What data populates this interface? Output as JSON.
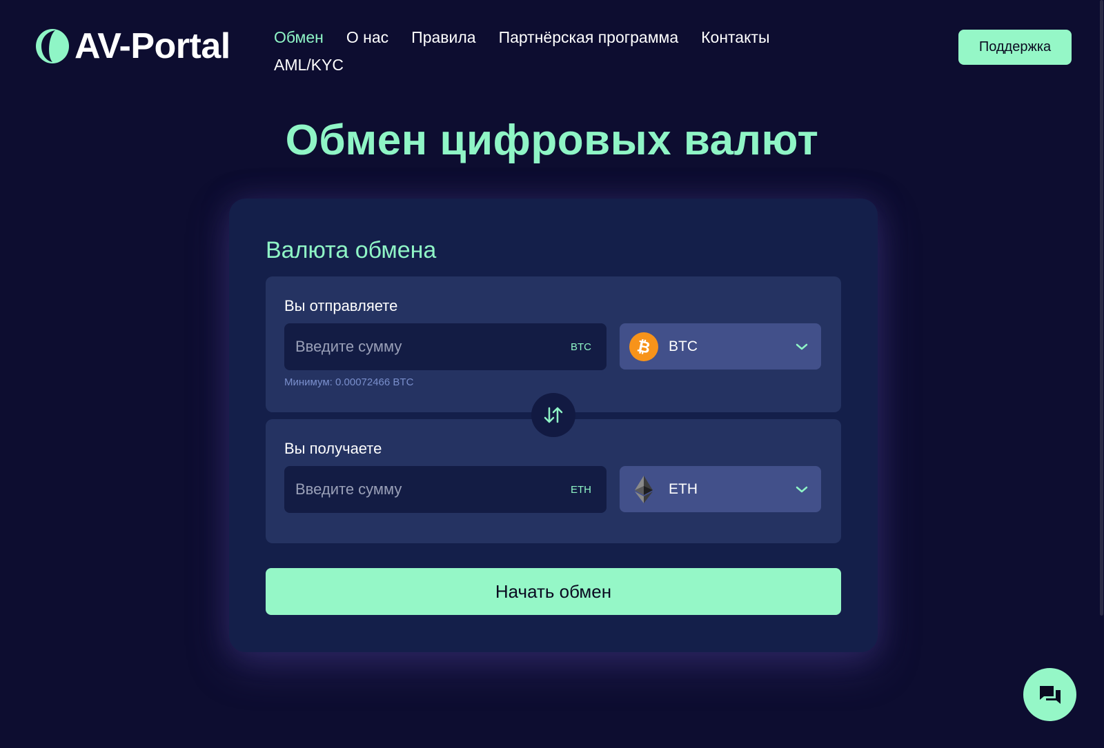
{
  "header": {
    "logo_text": "AV-Portal",
    "nav_row1": [
      "Обмен",
      "О нас",
      "Правила",
      "Партнёрская программа",
      "Контакты"
    ],
    "nav_row2": [
      "AML/KYC"
    ],
    "active_nav": "Обмен",
    "support_label": "Поддержка"
  },
  "main": {
    "title": "Обмен цифровых валют"
  },
  "exchange": {
    "title": "Валюта обмена",
    "send": {
      "label": "Вы отправляете",
      "placeholder": "Введите сумму",
      "unit": "BTC",
      "currency": "BTC",
      "currency_icon": "bitcoin-icon",
      "minimum_note": "Минимум: 0.00072466 BTC"
    },
    "receive": {
      "label": "Вы получаете",
      "placeholder": "Введите сумму",
      "unit": "ETH",
      "currency": "ETH",
      "currency_icon": "ethereum-icon"
    },
    "swap_icon": "swap-arrows-icon",
    "start_label": "Начать обмен"
  },
  "chat": {
    "icon": "chat-icon"
  },
  "colors": {
    "background": "#0d0d30",
    "accent": "#8ff5c6",
    "button": "#95f7c7",
    "card": "#141f4a",
    "panel": "#253362",
    "input": "#131c44",
    "select": "#42508a",
    "bitcoin": "#f7931a"
  }
}
